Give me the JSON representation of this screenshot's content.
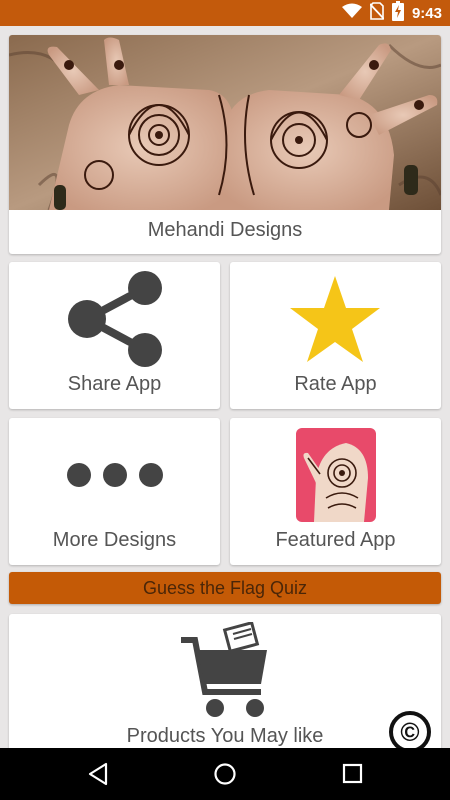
{
  "status_bar": {
    "time": "9:43",
    "bg_color": "#c35a0c",
    "icons": [
      "wifi-icon",
      "no-sim-icon",
      "battery-charging-icon"
    ]
  },
  "hero": {
    "label": "Mehandi Designs"
  },
  "tiles": [
    {
      "label": "Share App",
      "icon": "share-icon"
    },
    {
      "label": "Rate App",
      "icon": "star-icon"
    },
    {
      "label": "More Designs",
      "icon": "more-dots-icon"
    },
    {
      "label": "Featured App",
      "icon": "featured-app-icon"
    }
  ],
  "flag_quiz": {
    "label": "Guess the Flag Quiz",
    "bg_color": "#c45a06"
  },
  "products": {
    "label": "Products You May like",
    "icon": "shopping-cart-icon"
  },
  "copyright": {
    "symbol": "©"
  },
  "nav_bar": {
    "buttons": [
      "back-icon",
      "home-icon",
      "recents-icon"
    ]
  },
  "colors": {
    "accent": "#c45a06",
    "star": "#f5c518",
    "icon_gray": "#444444",
    "background": "#e8e6e6"
  }
}
